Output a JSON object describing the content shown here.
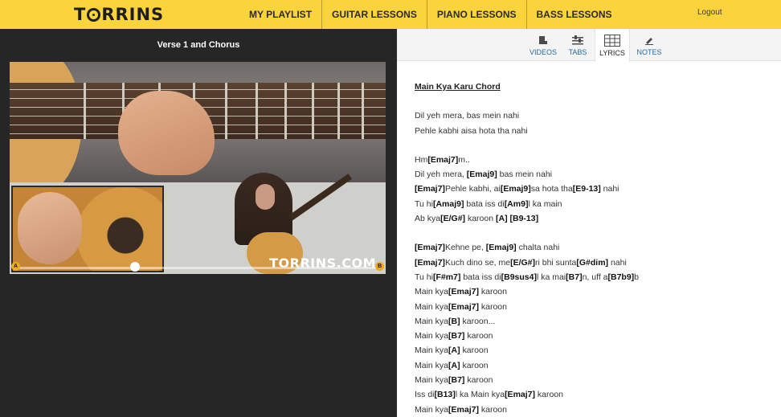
{
  "header": {
    "logo": "TORRINS",
    "nav": [
      "MY PLAYLIST",
      "GUITAR LESSONS",
      "PIANO LESSONS",
      "BASS LESSONS"
    ],
    "logout": "Logout",
    "accent_color": "#fbd33d"
  },
  "player": {
    "title": "Verse 1 and Chorus",
    "watermark": "TORRINS.COM",
    "marker_a": "A",
    "marker_b": "B",
    "progress": 0.33
  },
  "tabs": [
    {
      "label": "VIDEOS",
      "icon": "video-icon"
    },
    {
      "label": "TABS",
      "icon": "sliders-icon"
    },
    {
      "label": "LYRICS",
      "icon": "lyrics-sheet-icon",
      "active": true
    },
    {
      "label": "NOTES",
      "icon": "pencil-icon"
    }
  ],
  "lyrics": {
    "title": "Main Kya Karu Chord",
    "stanzas": [
      [
        [
          [
            "t",
            "Dil yeh mera, bas mein nahi"
          ]
        ],
        [
          [
            "t",
            "Pehle kabhi aisa hota tha nahi"
          ]
        ]
      ],
      [
        [
          [
            "t",
            "Hm"
          ],
          [
            "c",
            "[Emaj7]"
          ],
          [
            "t",
            "m.."
          ]
        ],
        [
          [
            "t",
            "Dil yeh mera, "
          ],
          [
            "c",
            "[Emaj9]"
          ],
          [
            "t",
            " bas mein nahi"
          ]
        ],
        [
          [
            "c",
            "[Emaj7]"
          ],
          [
            "t",
            "Pehle kabhi, ai"
          ],
          [
            "c",
            "[Emaj9]"
          ],
          [
            "t",
            "sa hota tha"
          ],
          [
            "c",
            "[E9-13]"
          ],
          [
            "t",
            " nahi"
          ]
        ],
        [
          [
            "t",
            "Tu hi"
          ],
          [
            "c",
            "[Amaj9]"
          ],
          [
            "t",
            " bata iss di"
          ],
          [
            "c",
            "[Am9]"
          ],
          [
            "t",
            "l ka main"
          ]
        ],
        [
          [
            "t",
            "Ab kya"
          ],
          [
            "c",
            "[E/G#]"
          ],
          [
            "t",
            " karoon "
          ],
          [
            "c",
            "[A]"
          ],
          [
            "t",
            " "
          ],
          [
            "c",
            "[B9-13]"
          ]
        ]
      ],
      [
        [
          [
            "c",
            "[Emaj7]"
          ],
          [
            "t",
            "Kehne pe, "
          ],
          [
            "c",
            "[Emaj9]"
          ],
          [
            "t",
            " chalta nahi"
          ]
        ],
        [
          [
            "c",
            "[Emaj7]"
          ],
          [
            "t",
            "Kuch dino se, me"
          ],
          [
            "c",
            "[E/G#]"
          ],
          [
            "t",
            "ri bhi sunta"
          ],
          [
            "c",
            "[G#dim]"
          ],
          [
            "t",
            " nahi"
          ]
        ],
        [
          [
            "t",
            "Tu hi"
          ],
          [
            "c",
            "[F#m7]"
          ],
          [
            "t",
            " bata iss di"
          ],
          [
            "c",
            "[B9sus4]"
          ],
          [
            "t",
            "l ka mai"
          ],
          [
            "c",
            "[B7]"
          ],
          [
            "t",
            "n, uff a"
          ],
          [
            "c",
            "[B7b9]"
          ],
          [
            "t",
            "b"
          ]
        ],
        [
          [
            "t",
            "Main kya"
          ],
          [
            "c",
            "[Emaj7]"
          ],
          [
            "t",
            " karoon"
          ]
        ],
        [
          [
            "t",
            "Main kya"
          ],
          [
            "c",
            "[Emaj7]"
          ],
          [
            "t",
            " karoon"
          ]
        ],
        [
          [
            "t",
            "Main kya"
          ],
          [
            "c",
            "[B]"
          ],
          [
            "t",
            " karoon..."
          ]
        ],
        [
          [
            "t",
            "Main kya"
          ],
          [
            "c",
            "[B7]"
          ],
          [
            "t",
            " karoon"
          ]
        ],
        [
          [
            "t",
            "Main kya"
          ],
          [
            "c",
            "[A]"
          ],
          [
            "t",
            " karoon"
          ]
        ],
        [
          [
            "t",
            "Main kya"
          ],
          [
            "c",
            "[A]"
          ],
          [
            "t",
            " karoon"
          ]
        ],
        [
          [
            "t",
            "Main kya"
          ],
          [
            "c",
            "[B7]"
          ],
          [
            "t",
            " karoon"
          ]
        ],
        [
          [
            "t",
            "Iss di"
          ],
          [
            "c",
            "[B13]"
          ],
          [
            "t",
            "l ka Main kya"
          ],
          [
            "c",
            "[Emaj7]"
          ],
          [
            "t",
            " karoon"
          ]
        ],
        [
          [
            "t",
            "Main kya"
          ],
          [
            "c",
            "[Emaj7]"
          ],
          [
            "t",
            " karoon"
          ]
        ]
      ]
    ]
  }
}
